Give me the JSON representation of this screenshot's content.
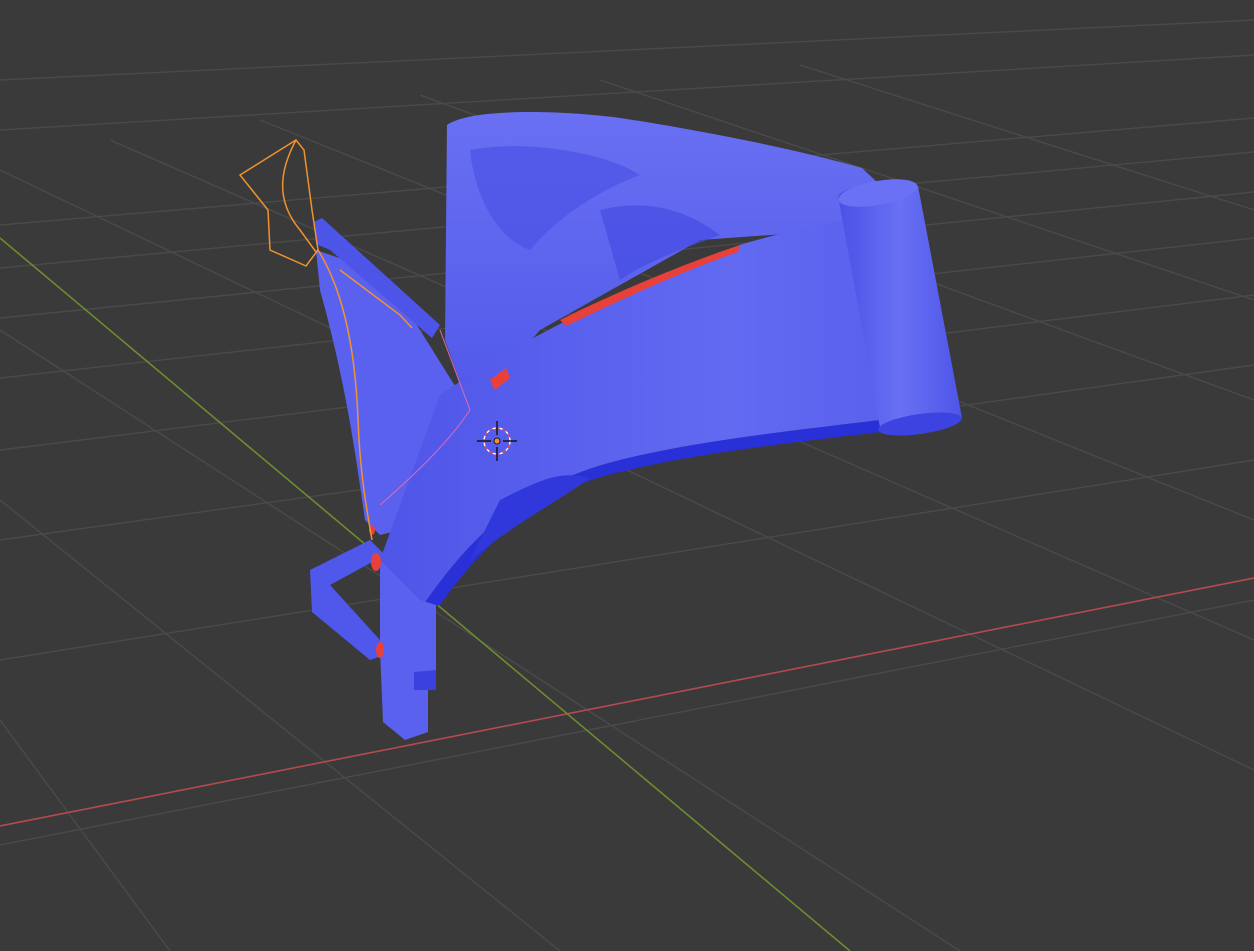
{
  "viewport": {
    "background": "#3a3a3a",
    "grid_color": "#4c4c4c",
    "x_axis_color": "#b54a4f",
    "y_axis_color": "#6d8b2f",
    "selection_outline_color": "#f0922e",
    "mesh_color": "#5960f0",
    "backface_color": "#e8413a"
  },
  "icons": {
    "cursor": "3d-cursor-icon",
    "origin": "object-origin-icon"
  },
  "objects": [
    {
      "name": "blue-mesh",
      "selected": false
    },
    {
      "name": "selected-outline-mesh",
      "selected": true
    }
  ]
}
